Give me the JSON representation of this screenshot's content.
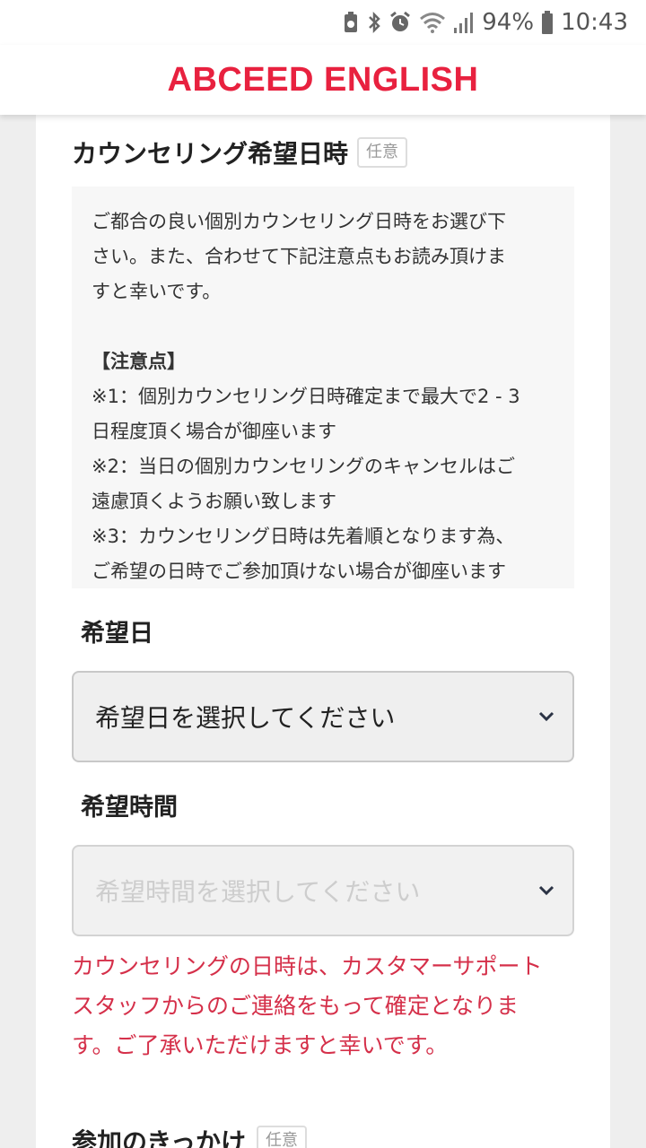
{
  "status_bar": {
    "battery": "94%",
    "time": "10:43",
    "icons": [
      "cleaner-icon",
      "bluetooth-icon",
      "alarm-icon",
      "wifi-icon",
      "signal-icon",
      "battery-icon"
    ]
  },
  "header": {
    "brand": "ABCEED ENGLISH",
    "brand_color": "#e8213f"
  },
  "section": {
    "title": "カウンセリング希望日時",
    "badge": "任意"
  },
  "notice": {
    "intro_lines": [
      "ご都合の良い個別カウンセリング日時をお選び下",
      "さい。また、合わせて下記注意点もお読み頂けま",
      "すと幸いです。"
    ],
    "heading": "【注意点】",
    "items": [
      "※1：個別カウンセリング日時確定まで最大で2 - 3",
      "日程度頂く場合が御座います",
      "※2：当日の個別カウンセリングのキャンセルはご",
      "遠慮頂くようお願い致します",
      "※3：カウンセリング日時は先着順となります為、",
      "ご希望の日時でご参加頂けない場合が御座います"
    ]
  },
  "date_field": {
    "label": "希望日",
    "placeholder": "希望日を選択してください"
  },
  "time_field": {
    "label": "希望時間",
    "placeholder": "希望時間を選択してください"
  },
  "warning": {
    "lines": [
      "カウンセリングの日時は、カスタマーサポート",
      "スタッフからのご連絡をもって確定となりま",
      "す。ご了承いただけますと幸いです。"
    ],
    "color": "#d5304a"
  },
  "next_section": {
    "title": "参加のきっかけ",
    "badge": "任意"
  }
}
